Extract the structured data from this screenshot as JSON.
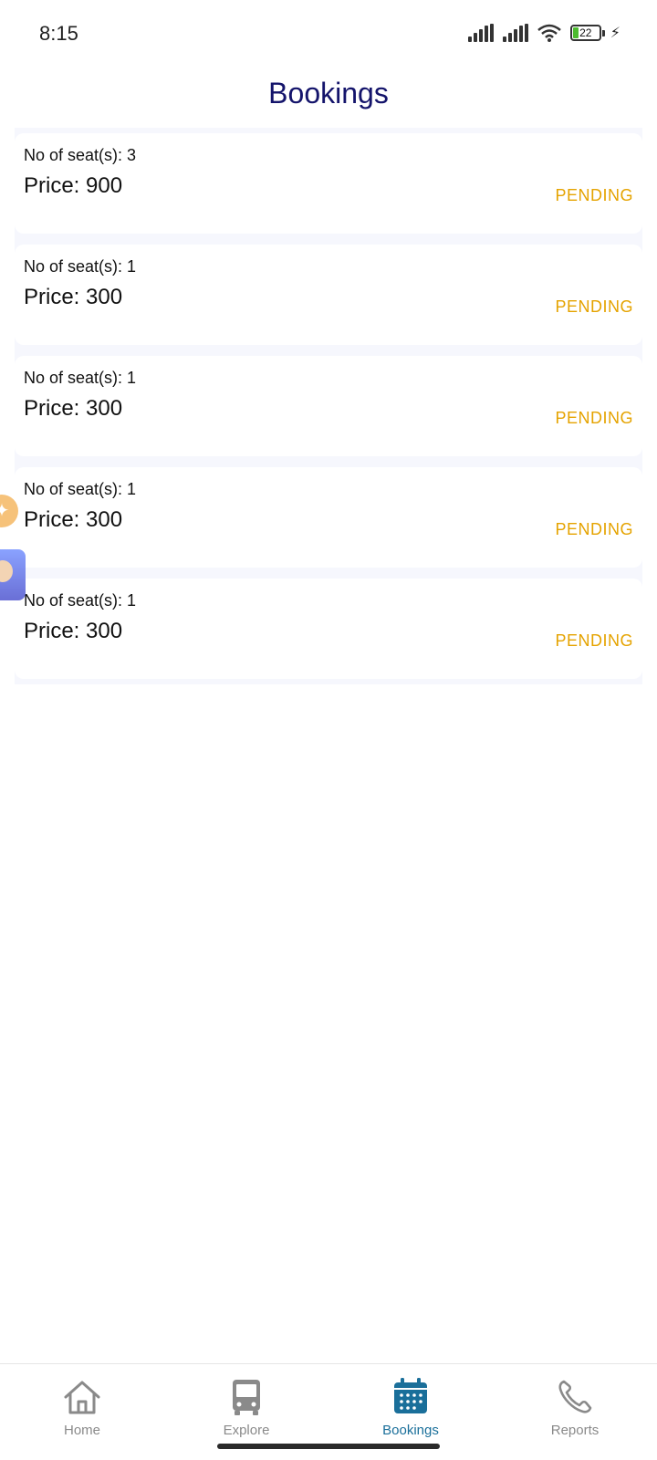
{
  "status_bar": {
    "time": "8:15",
    "battery": "22"
  },
  "page": {
    "title": "Bookings"
  },
  "bookings": [
    {
      "seats": "No of seat(s): 3",
      "price": "Price: 900",
      "status": "PENDING"
    },
    {
      "seats": "No of seat(s): 1",
      "price": "Price: 300",
      "status": "PENDING"
    },
    {
      "seats": "No of seat(s): 1",
      "price": "Price: 300",
      "status": "PENDING"
    },
    {
      "seats": "No of seat(s): 1",
      "price": "Price: 300",
      "status": "PENDING"
    },
    {
      "seats": "No of seat(s): 1",
      "price": "Price: 300",
      "status": "PENDING"
    }
  ],
  "nav": {
    "items": [
      {
        "label": "Home",
        "icon": "home-icon"
      },
      {
        "label": "Explore",
        "icon": "bus-icon"
      },
      {
        "label": "Bookings",
        "icon": "calendar-icon",
        "active": true
      },
      {
        "label": "Reports",
        "icon": "phone-icon"
      }
    ]
  },
  "colors": {
    "title": "#14146b",
    "status_pending": "#e5a300",
    "active_nav": "#1a6f9a",
    "inactive_nav": "#8a8a8a",
    "list_bg": "#f6f7fd"
  }
}
